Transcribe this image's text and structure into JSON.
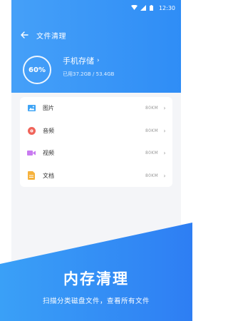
{
  "status_bar": {
    "time": "12:30"
  },
  "app_bar": {
    "title": "文件清理"
  },
  "storage": {
    "percent": "60%",
    "title": "手机存储",
    "detail": "已用37.2GB / 53.4GB"
  },
  "categories": [
    {
      "label": "图片",
      "size": "80KM",
      "icon": "image-icon"
    },
    {
      "label": "音频",
      "size": "80KM",
      "icon": "music-icon"
    },
    {
      "label": "视频",
      "size": "80KM",
      "icon": "video-icon"
    },
    {
      "label": "文档",
      "size": "80KM",
      "icon": "document-icon"
    }
  ],
  "promo": {
    "title": "内存清理",
    "subtitle": "扫描分类磁盘文件，查看所有文件"
  },
  "colors": {
    "primary": "#2f8df6",
    "image": "#3fa4f5",
    "music": "#f0645a",
    "video": "#c97bf0",
    "document": "#f6b23c"
  }
}
